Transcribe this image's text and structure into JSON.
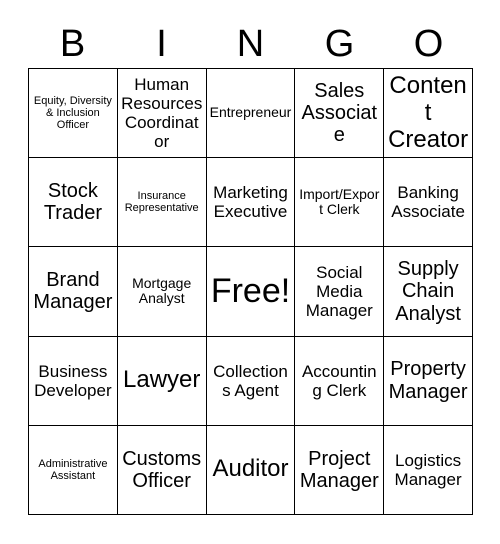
{
  "card": {
    "title": "BINGO",
    "header_letters": [
      "B",
      "I",
      "N",
      "G",
      "O"
    ],
    "background_color": "#ffffff",
    "border_color": "#000000",
    "text_color": "#000000",
    "rows": 5,
    "columns": 5,
    "free_space_label": "Free!",
    "free_space_index": 12,
    "cells": [
      {
        "text": "Equity, Diversity & Inclusion Officer",
        "size": "xs"
      },
      {
        "text": "Human Resources Coordinator",
        "size": "md"
      },
      {
        "text": "Entrepreneur",
        "size": "sm"
      },
      {
        "text": "Sales Associate",
        "size": "lg"
      },
      {
        "text": "Content Creator",
        "size": "xl"
      },
      {
        "text": "Stock Trader",
        "size": "lg"
      },
      {
        "text": "Insurance Representative",
        "size": "xs"
      },
      {
        "text": "Marketing Executive",
        "size": "md"
      },
      {
        "text": "Import/Export Clerk",
        "size": "sm"
      },
      {
        "text": "Banking Associate",
        "size": "md"
      },
      {
        "text": "Brand Manager",
        "size": "lg"
      },
      {
        "text": "Mortgage Analyst",
        "size": "sm"
      },
      {
        "text": "Free!",
        "size": "xxl"
      },
      {
        "text": "Social Media Manager",
        "size": "md"
      },
      {
        "text": "Supply Chain Analyst",
        "size": "lg"
      },
      {
        "text": "Business Developer",
        "size": "md"
      },
      {
        "text": "Lawyer",
        "size": "xl"
      },
      {
        "text": "Collections Agent",
        "size": "md"
      },
      {
        "text": "Accounting Clerk",
        "size": "md"
      },
      {
        "text": "Property Manager",
        "size": "lg"
      },
      {
        "text": "Administrative Assistant",
        "size": "xs"
      },
      {
        "text": "Customs Officer",
        "size": "lg"
      },
      {
        "text": "Auditor",
        "size": "xl"
      },
      {
        "text": "Project Manager",
        "size": "lg"
      },
      {
        "text": "Logistics Manager",
        "size": "md"
      }
    ]
  }
}
